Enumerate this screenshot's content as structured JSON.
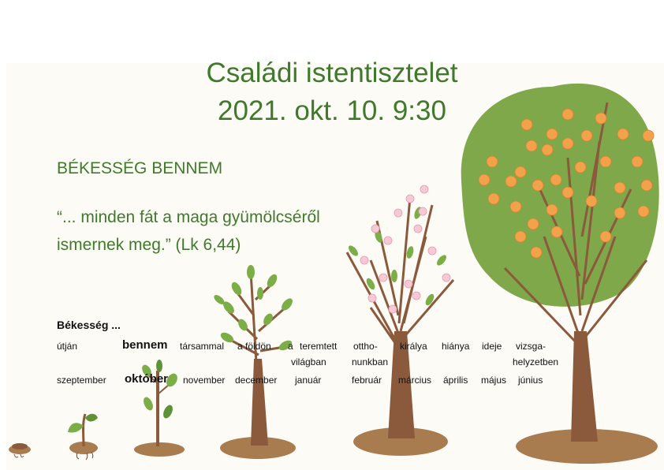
{
  "title_line1": "Családi istentisztelet",
  "title_line2": "2021. okt. 10. 9:30",
  "subtitle": "BÉKESSÉG BENNEM",
  "quote_line1": "“... minden fát a maga gyümölcséről",
  "quote_line2": "ismernek meg.” (Lk 6,44)",
  "bekesseg_label": "Békesség ...",
  "words": {
    "w1": "útján",
    "w2": "bennem",
    "w3": "társammal",
    "w4": "a földön",
    "w5a": "a",
    "w5b": "teremtett",
    "w5c": "világban",
    "w6a": "ottho-",
    "w6b": "nunkban",
    "w7": "királya",
    "w8": "hiánya",
    "w9": "ideje",
    "w10a": "vizsga-",
    "w10b": "helyzetben"
  },
  "months": {
    "m1": "szeptember",
    "m2": "október",
    "m3": "november",
    "m4": "december",
    "m5": "január",
    "m6": "február",
    "m7": "március",
    "m8": "április",
    "m9": "május",
    "m10": "június"
  },
  "colors": {
    "title_green": "#3f7a2c",
    "soil": "#a97c50",
    "trunk": "#8b5a3c",
    "leaf": "#7cae47",
    "canopy": "#7fa84a",
    "fruit": "#f2a24a",
    "blossom": "#f6c9d6"
  }
}
